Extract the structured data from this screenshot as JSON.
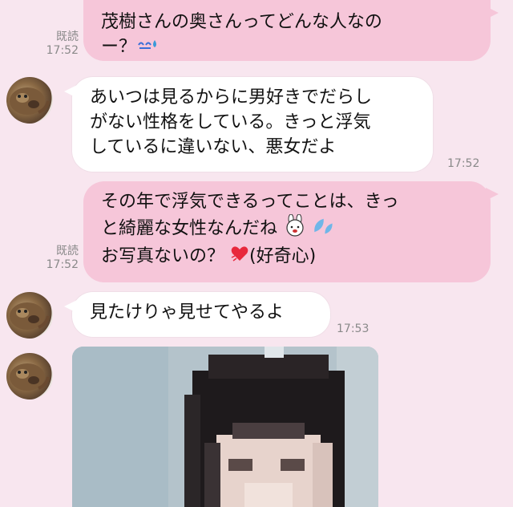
{
  "messages": [
    {
      "side": "sent",
      "read": "既読",
      "time": "17:52",
      "lines": [
        "茂樹さんの奥さんってどんな人なの",
        "ー？"
      ],
      "emoji": "sweat-icon"
    },
    {
      "side": "recv",
      "time": "17:52",
      "lines": [
        "あいつは見るからに男好きでだらし",
        "がない性格をしている。きっと浮気",
        "しているに違いない、悪女だよ"
      ]
    },
    {
      "side": "sent",
      "read": "既読",
      "time": "17:52",
      "lines": [
        "その年で浮気できるってことは、きっ",
        "と綺麗な女性なんだね",
        "お写真ないの？",
        "(好奇心)"
      ]
    },
    {
      "side": "recv",
      "time": "17:53",
      "lines": [
        "見たけりゃ見せてやるよ"
      ]
    }
  ],
  "colors": {
    "background": "#f8e6ef",
    "sent_bubble": "#f6c6d9",
    "recv_bubble": "#ffffff",
    "meta": "#8a8a8a"
  }
}
